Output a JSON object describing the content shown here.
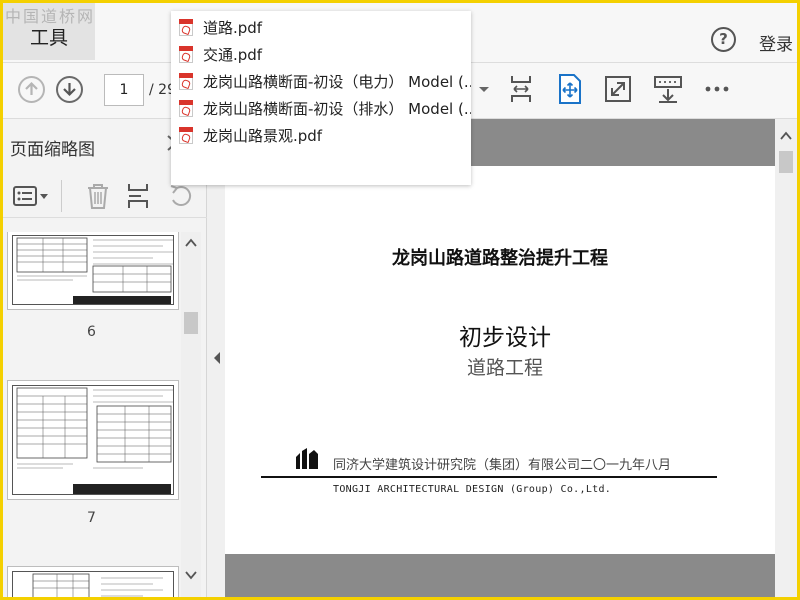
{
  "watermark": "中国道桥网",
  "header": {
    "tools_label": "工具",
    "help_icon": "help-icon",
    "login_label": "登录"
  },
  "toolbar": {
    "current_page": "1",
    "total_pages": "/ 29",
    "icons": [
      "prev-page-icon",
      "next-page-icon",
      "fit-width-icon",
      "fit-page-icon",
      "fullscreen-icon",
      "read-mode-icon",
      "more-icon"
    ]
  },
  "file_dropdown": {
    "items": [
      {
        "label": "道路.pdf",
        "icon": "pdf-icon"
      },
      {
        "label": "交通.pdf",
        "icon": "pdf-icon"
      },
      {
        "label": "龙岗山路横断面-初设（电力） Model (..",
        "icon": "pdf-icon"
      },
      {
        "label": "龙岗山路横断面-初设（排水） Model (..",
        "icon": "pdf-icon"
      },
      {
        "label": "龙岗山路景观.pdf",
        "icon": "pdf-icon"
      }
    ]
  },
  "left_panel": {
    "title": "页面缩略图",
    "thumbnails": [
      {
        "page_label": "6"
      },
      {
        "page_label": "7"
      },
      {
        "page_label": ""
      }
    ]
  },
  "document": {
    "project_title": "龙岗山路道路整治提升工程",
    "stage": "初步设计",
    "subtitle": "道路工程",
    "organization": "同济大学建筑设计研究院（集团）有限公司二〇一九年八月",
    "organization_en": "TONGJI ARCHITECTURAL DESIGN (Group) Co.,Ltd."
  },
  "colors": {
    "accent_blue": "#1a73c8",
    "pdf_red": "#d9342b",
    "frame_yellow": "#f4d000"
  }
}
